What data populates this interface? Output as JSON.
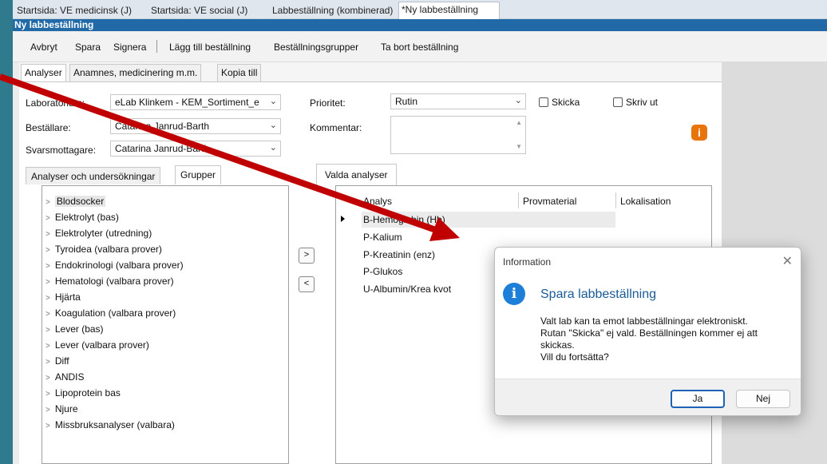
{
  "top_tabs": [
    {
      "label": "Startsida: VE medicinsk (J)"
    },
    {
      "label": "Startsida: VE social (J)"
    },
    {
      "label": "Labbeställning (kombinerad)"
    },
    {
      "label": "*Ny labbeställning"
    }
  ],
  "window_title": "Ny labbeställning",
  "toolbar": {
    "cancel": "Avbryt",
    "save": "Spara",
    "sign": "Signera",
    "add_order": "Lägg till beställning",
    "order_groups": "Beställningsgrupper",
    "remove_order": "Ta bort beställning"
  },
  "form_tabs": [
    {
      "label": "Analyser"
    },
    {
      "label": "Anamnes, medicinering m.m."
    },
    {
      "label": "Kopia till"
    }
  ],
  "fields": {
    "laboratory_label": "Laboratorium:",
    "laboratory_value": "eLab Klinkem - KEM_Sortiment_e",
    "orderer_label": "Beställare:",
    "orderer_value": "Catarina Janrud-Barth",
    "recipient_label": "Svarsmottagare:",
    "recipient_value": "Catarina Janrud-Barth",
    "priority_label": "Prioritet:",
    "priority_value": "Rutin",
    "comment_label": "Kommentar:",
    "send_label": "Skicka",
    "send_checked": false,
    "print_label": "Skriv ut",
    "print_checked": false
  },
  "left_tabs": [
    {
      "label": "Analyser och undersökningar"
    },
    {
      "label": "Grupper"
    }
  ],
  "groups": [
    "Blodsocker",
    "Elektrolyt (bas)",
    "Elektrolyter (utredning)",
    "Tyroidea (valbara prover)",
    "Endokrinologi (valbara prover)",
    "Hematologi (valbara prover)",
    "Hjärta",
    "Koagulation (valbara prover)",
    "Lever (bas)",
    "Lever (valbara prover)",
    "Diff",
    "ANDIS",
    "Lipoprotein bas",
    "Njure",
    "Missbruksanalyser (valbara)"
  ],
  "move_buttons": {
    "add": ">",
    "remove": "<"
  },
  "selected_tab": "Valda analyser",
  "grid": {
    "columns": [
      "Analys",
      "Provmaterial",
      "Lokalisation"
    ],
    "rows": [
      "B-Hemoglobin (Hb)",
      "P-Kalium",
      "P-Kreatinin (enz)",
      "P-Glukos",
      "U-Albumin/Krea kvot"
    ]
  },
  "dialog": {
    "title": "Information",
    "heading": "Spara labbeställning",
    "body_line1": "Valt lab kan ta emot labbeställningar elektroniskt.",
    "body_line2": "Rutan \"Skicka\" ej vald. Beställningen kommer ej att skickas.",
    "body_line3": "Vill du fortsätta?",
    "yes": "Ja",
    "no": "Nej"
  },
  "colors": {
    "desktop": "#2f7a8c",
    "title_bar": "#2169a7",
    "annotation_arrow": "#c00000",
    "info_badge": "#e8740c",
    "dialog_icon": "#1e7fd8"
  }
}
